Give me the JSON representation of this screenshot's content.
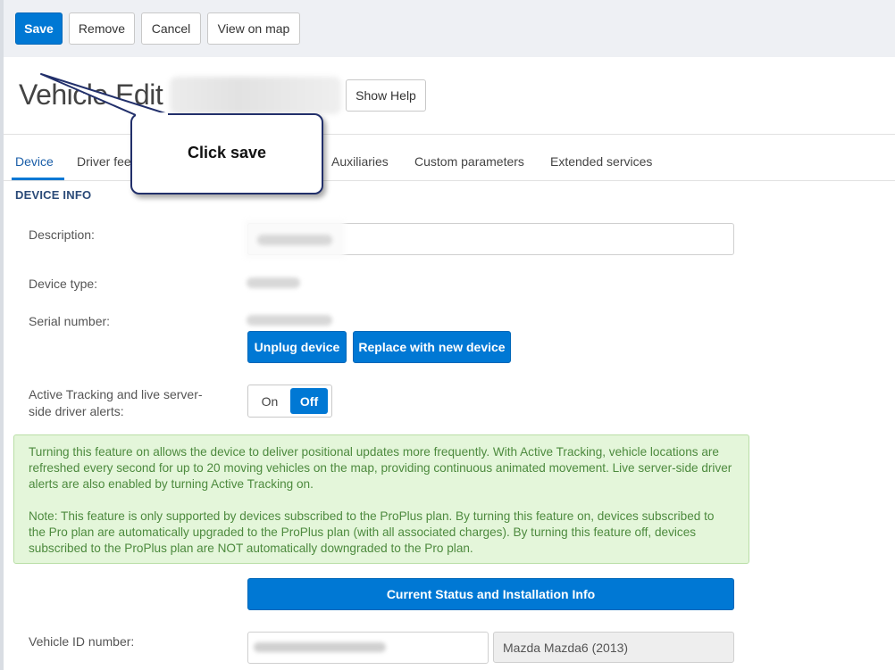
{
  "toolbar": {
    "save_label": "Save",
    "remove_label": "Remove",
    "cancel_label": "Cancel",
    "view_on_map_label": "View on map"
  },
  "header": {
    "title_prefix": "Vehicle Edit",
    "show_help_label": "Show Help"
  },
  "tabs": [
    {
      "label": "Device",
      "active": true
    },
    {
      "label": "Driver feedback"
    },
    {
      "label": "Auxiliaries"
    },
    {
      "label": "Custom parameters"
    },
    {
      "label": "Extended services"
    }
  ],
  "device_info": {
    "section_title": "DEVICE INFO",
    "description_label": "Description:",
    "device_type_label": "Device type:",
    "serial_number_label": "Serial number:",
    "unplug_label": "Unplug device",
    "replace_label": "Replace with new device",
    "active_tracking_label_line1": "Active Tracking and live server-",
    "active_tracking_label_line2": "side driver alerts:",
    "toggle_on": "On",
    "toggle_off": "Off",
    "toggle_selected": "Off"
  },
  "info_box": {
    "paragraph1": "Turning this feature on allows the device to deliver positional updates more frequently. With Active Tracking, vehicle locations are refreshed every second for up to 20 moving vehicles on the map, providing continuous animated movement. Live server-side driver alerts are also enabled by turning Active Tracking on.",
    "paragraph2": "Note: This feature is only supported by devices subscribed to the ProPlus plan. By turning this feature on, devices subscribed to the Pro plan are automatically upgraded to the ProPlus plan (with all associated charges). By turning this feature off, devices subscribed to the ProPlus plan are NOT automatically downgraded to the Pro plan."
  },
  "status_button_label": "Current Status and Installation Info",
  "vehicle": {
    "vin_label": "Vehicle ID number:",
    "model": "Mazda Mazda6 (2013)"
  },
  "callout": {
    "text": "Click save"
  },
  "colors": {
    "primary": "#0078d4",
    "callout_border": "#22306b",
    "info_bg": "#e4f6da",
    "info_text": "#4d8a3e"
  }
}
